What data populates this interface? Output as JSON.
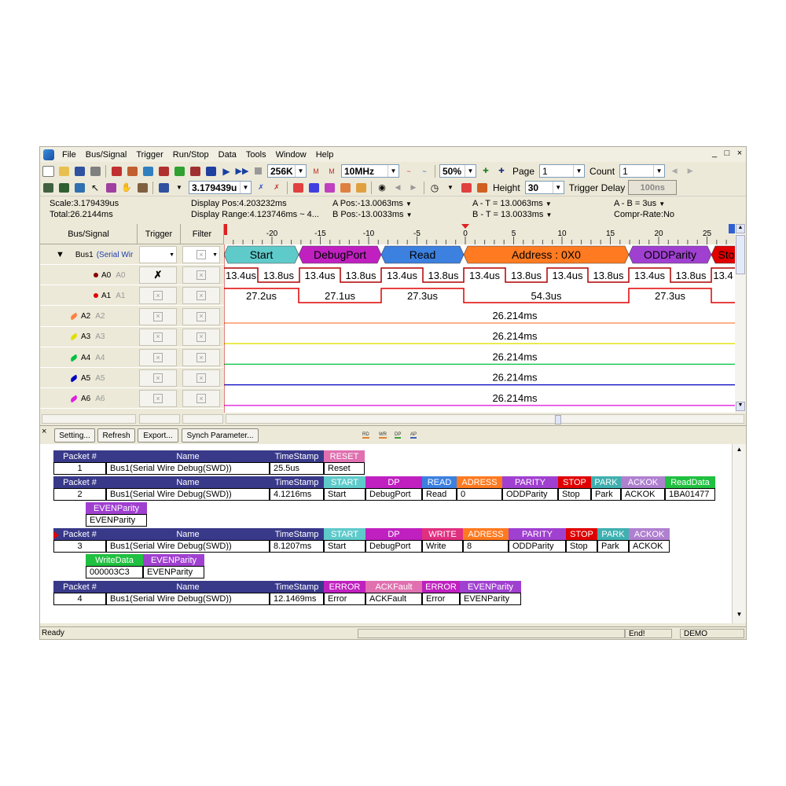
{
  "menu": [
    "File",
    "Bus/Signal",
    "Trigger",
    "Run/Stop",
    "Data",
    "Tools",
    "Window",
    "Help"
  ],
  "window_controls": [
    "_",
    "□",
    "×"
  ],
  "toolbar1": {
    "depth": "256K",
    "rate": "10MHz",
    "zoom": "50%",
    "page_label": "Page",
    "page_value": "1",
    "count_label": "Count",
    "count_value": "1"
  },
  "toolbar2": {
    "scale_value": "3.179439u",
    "height_label": "Height",
    "height_value": "30",
    "trigger_delay_label": "Trigger Delay",
    "trigger_delay_value": "100ns"
  },
  "info": {
    "scale": "Scale:3.179439us",
    "total": "Total:26.2144ms",
    "display_pos": "Display Pos:4.203232ms",
    "display_range": "Display Range:4.123746ms ~ 4...",
    "a_pos": "A Pos:-13.0063ms",
    "b_pos": "B Pos:-13.0033ms",
    "a_t": "A - T = 13.0063ms",
    "b_t": "B - T = 13.0033ms",
    "a_b": "A - B = 3us",
    "compr": "Compr-Rate:No"
  },
  "signal_headers": {
    "name": "Bus/Signal",
    "trigger": "Trigger",
    "filter": "Filter"
  },
  "signals": [
    {
      "label": "Bus1",
      "sub": "(Serial Wir",
      "color": "#000000"
    },
    {
      "label": "A0",
      "sub": "A0",
      "color": "#8b0000"
    },
    {
      "label": "A1",
      "sub": "A1",
      "color": "#e00000"
    },
    {
      "label": "A2",
      "sub": "A2",
      "color": "#ff8040"
    },
    {
      "label": "A3",
      "sub": "A3",
      "color": "#e0e000"
    },
    {
      "label": "A4",
      "sub": "A4",
      "color": "#00c040"
    },
    {
      "label": "A5",
      "sub": "A5",
      "color": "#0000c0"
    },
    {
      "label": "A6",
      "sub": "A6",
      "color": "#e020e0"
    }
  ],
  "timeline": {
    "ticks": [
      "-20",
      "-15",
      "-10",
      "-5",
      "0",
      "5",
      "10",
      "15",
      "20",
      "25"
    ]
  },
  "bus_segments": [
    {
      "label": "Start",
      "color": "#5fcaca"
    },
    {
      "label": "DebugPort",
      "color": "#c020c0"
    },
    {
      "label": "Read",
      "color": "#3c80e0"
    },
    {
      "label": "Address : 0X0",
      "color": "#ff7a20"
    },
    {
      "label": "ODDParity",
      "color": "#a040d0"
    },
    {
      "label": "Sto",
      "color": "#e00000"
    }
  ],
  "a0_labels": [
    "13.4us",
    "13.8us",
    "13.4us",
    "13.8us",
    "13.4us",
    "13.8us",
    "13.4us",
    "13.8us",
    "13.4us",
    "13.8us",
    "13.4us",
    "13.8us",
    "13.4"
  ],
  "a1_labels": [
    "27.2us",
    "27.1us",
    "27.3us",
    "54.3us",
    "27.3us"
  ],
  "flat_label": "26.214ms",
  "decoder_buttons": [
    "Setting...",
    "Refresh",
    "Export...",
    "Synch Parameter..."
  ],
  "decoder_tags": [
    "RD",
    "WR",
    "DP",
    "AP"
  ],
  "packets": [
    {
      "headers": [
        {
          "t": "Packet #",
          "c": "#39398a"
        },
        {
          "t": "Name",
          "c": "#39398a"
        },
        {
          "t": "TimeStamp",
          "c": "#39398a"
        },
        {
          "t": "RESET",
          "c": "#e070b0"
        }
      ],
      "values": [
        "1",
        "Bus1(Serial Wire Debug(SWD))",
        "25.5us",
        "Reset"
      ]
    },
    {
      "headers": [
        {
          "t": "Packet #",
          "c": "#39398a"
        },
        {
          "t": "Name",
          "c": "#39398a"
        },
        {
          "t": "TimeStamp",
          "c": "#39398a"
        },
        {
          "t": "START",
          "c": "#5fcaca"
        },
        {
          "t": "DP",
          "c": "#c020c0"
        },
        {
          "t": "READ",
          "c": "#3c80e0"
        },
        {
          "t": "ADRESS",
          "c": "#ff7a20"
        },
        {
          "t": "PARITY",
          "c": "#a040d0"
        },
        {
          "t": "STOP",
          "c": "#e00000"
        },
        {
          "t": "PARK",
          "c": "#40b0b0"
        },
        {
          "t": "ACKOK",
          "c": "#b080d0"
        },
        {
          "t": "ReadData",
          "c": "#20c040"
        }
      ],
      "values": [
        "2",
        "Bus1(Serial Wire Debug(SWD))",
        "4.1216ms",
        "Start",
        "DebugPort",
        "Read",
        "0",
        "ODDParity",
        "Stop",
        "Park",
        "ACKOK",
        "1BA01477"
      ],
      "cont_header": {
        "t": "EVENParity",
        "c": "#a040d0"
      },
      "cont_value": "EVENParity"
    },
    {
      "headers": [
        {
          "t": "Packet #",
          "c": "#39398a"
        },
        {
          "t": "Name",
          "c": "#39398a"
        },
        {
          "t": "TimeStamp",
          "c": "#39398a"
        },
        {
          "t": "START",
          "c": "#5fcaca"
        },
        {
          "t": "DP",
          "c": "#c020c0"
        },
        {
          "t": "WRITE",
          "c": "#e03080"
        },
        {
          "t": "ADRESS",
          "c": "#ff7a20"
        },
        {
          "t": "PARITY",
          "c": "#a040d0"
        },
        {
          "t": "STOP",
          "c": "#e00000"
        },
        {
          "t": "PARK",
          "c": "#40b0b0"
        },
        {
          "t": "ACKOK",
          "c": "#b080d0"
        }
      ],
      "values": [
        "3",
        "Bus1(Serial Wire Debug(SWD))",
        "8.1207ms",
        "Start",
        "DebugPort",
        "Write",
        "8",
        "ODDParity",
        "Stop",
        "Park",
        "ACKOK"
      ],
      "cont_headers": [
        {
          "t": "WriteData",
          "c": "#20c040"
        },
        {
          "t": "EVENParity",
          "c": "#a040d0"
        }
      ],
      "cont_values": [
        "000003C3",
        "EVENParity"
      ]
    },
    {
      "headers": [
        {
          "t": "Packet #",
          "c": "#39398a"
        },
        {
          "t": "Name",
          "c": "#39398a"
        },
        {
          "t": "TimeStamp",
          "c": "#39398a"
        },
        {
          "t": "ERROR",
          "c": "#c020c0"
        },
        {
          "t": "ACKFault",
          "c": "#e070b0"
        },
        {
          "t": "ERROR",
          "c": "#c020c0"
        },
        {
          "t": "EVENParity",
          "c": "#a040d0"
        }
      ],
      "values": [
        "4",
        "Bus1(Serial Wire Debug(SWD))",
        "12.1469ms",
        "Error",
        "ACKFault",
        "Error",
        "EVENParity"
      ]
    }
  ],
  "status": {
    "left": "Ready",
    "mid": "End!",
    "right": "DEMO"
  }
}
